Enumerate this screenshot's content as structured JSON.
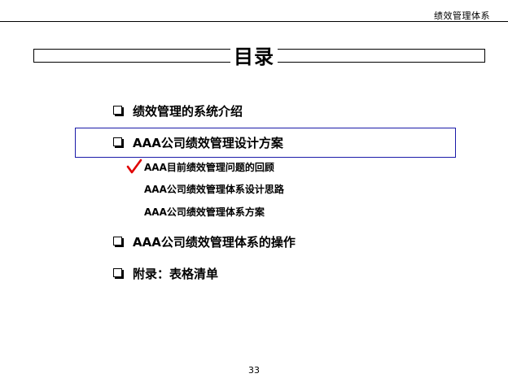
{
  "header": {
    "title": "绩效管理体系"
  },
  "page_title": "目录",
  "toc": {
    "items": [
      {
        "label": "绩效管理的系统介绍"
      },
      {
        "label": "AAA公司绩效管理设计方案"
      },
      {
        "label": "AAA公司绩效管理体系的操作"
      },
      {
        "label": "附录：表格清单"
      }
    ],
    "sub_items": [
      {
        "label": "AAA目前绩效管理问题的回顾"
      },
      {
        "label": "AAA公司绩效管理体系设计思路"
      },
      {
        "label": "AAA公司绩效管理体系方案"
      }
    ]
  },
  "colors": {
    "highlight_border": "#1a1aa8",
    "checkmark": "#e00000"
  },
  "icons": {
    "bullet": "hollow-square-bullet-icon",
    "current": "red-checkmark-icon"
  },
  "page_number": "33"
}
